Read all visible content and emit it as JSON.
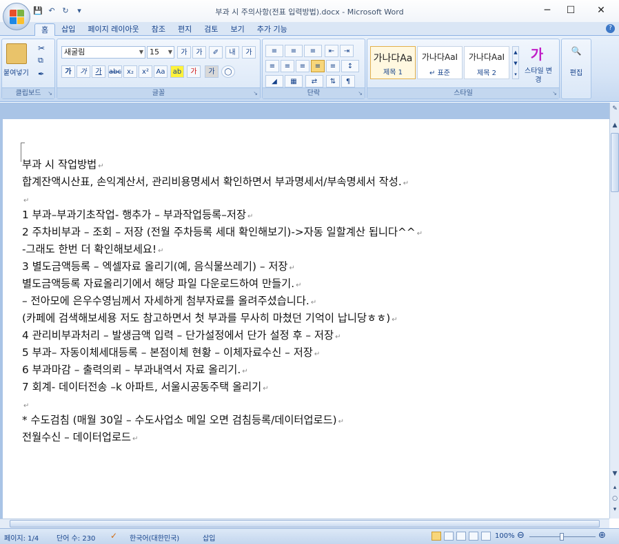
{
  "window": {
    "title": "부과 시 주의사항(전표 입력방법).docx - Microsoft Word",
    "minimize": "─",
    "maximize": "☐",
    "close": "✕"
  },
  "qat": [
    "save-icon",
    "undo-icon",
    "redo-icon",
    "customize-icon"
  ],
  "tabs": [
    "홈",
    "삽입",
    "페이지 레이아웃",
    "참조",
    "편지",
    "검토",
    "보기",
    "추가 기능"
  ],
  "ribbon": {
    "clipboard": {
      "label": "클립보드",
      "paste": "붙여넣기"
    },
    "font": {
      "label": "글꼴",
      "font_name": "새굴림",
      "font_size": "15"
    },
    "paragraph": {
      "label": "단락"
    },
    "styles": {
      "label": "스타일",
      "items": [
        {
          "preview": "가나다Aa",
          "name": "제목 1"
        },
        {
          "preview": "가나다AaI",
          "name": "↵ 표준"
        },
        {
          "preview": "가나다AaI",
          "name": "제목 2"
        }
      ],
      "change_style": "스타일 변경",
      "edit": "편집"
    }
  },
  "document": {
    "lines": [
      "부과 시 작업방법",
      "합계잔액시산표, 손익계산서, 관리비용명세서 확인하면서 부과명세서/부속명세서 작성.",
      "",
      "1 부과–부과기초작업- 행추가 – 부과작업등록–저장",
      "2 주차비부과 – 조회 – 저장 (전월 주차등록 세대 확인해보기)->자동 일할계산 됩니다^^",
      "-그래도 한번 더 확인해보세요!",
      "3 별도금액등록 – 엑셀자료 올리기(예, 음식물쓰레기) – 저장",
      "별도금액등록 자료올리기에서 해당 파일 다운로드하여 만들기.",
      "– 전아모에 은우수영님께서 자세하게 첨부자료를 올려주셨습니다.",
      "(카페에 검색해보세용 저도 참고하면서 첫 부과를 무사히 마쳤던 기억이 납니당ㅎㅎ)",
      "4 관리비부과처리 – 발생금액 입력 – 단가설정에서 단가 설정 후 – 저장",
      "5 부과– 자동이체세대등록 – 본점이체 현황 – 이체자료수신 – 저장",
      "6 부과마감 – 출력의뢰 – 부과내역서 자료 올리기.",
      "7 회계- 데이터전송 –k 아파트, 서울시공동주택 올리기",
      "",
      "* 수도검침 (매월 30일 – 수도사업소 메일 오면 검침등록/데이터업로드)",
      "전월수신 – 데이터업로드"
    ]
  },
  "status": {
    "page": "페이지: 1/4",
    "words": "단어 수: 230",
    "language": "한국어(대한민국)",
    "mode": "삽입",
    "zoom": "100%"
  }
}
